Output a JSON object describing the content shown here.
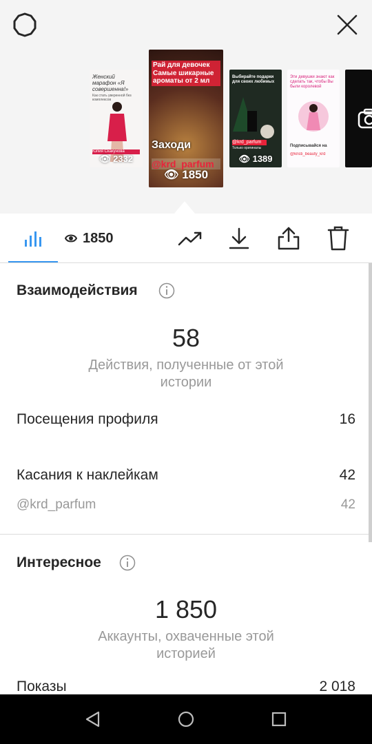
{
  "stories": [
    {
      "caption_top": "Женский марафон «Я совершенна!»",
      "caption_small": "Как стать уверенной без комплексов",
      "label": "Юлия Скакунова",
      "views": "2332"
    },
    {
      "caption_top": "Рай для девочек Самые шикарные ароматы от 2 мл",
      "caption_mid": "Заходи",
      "handle": "@krd_parfum",
      "views": "1850"
    },
    {
      "caption_top": "Выбирайте подарки для своих любимых",
      "handle": "@krd_parfum",
      "caption_small": "Только оригиналы",
      "views": "1389"
    },
    {
      "caption_top": "Эти девушки знают как сделать так, чтобы Вы были королевой",
      "caption_small": "Подписывайся на",
      "handle": "@kristi_beauty_krd"
    },
    {}
  ],
  "toolbar": {
    "views_count": "1850"
  },
  "interactions": {
    "title": "Взаимодействия",
    "total": "58",
    "total_caption": "Действия, полученные от этой истории",
    "rows": [
      {
        "label": "Посещения профиля",
        "value": "16"
      },
      {
        "label": "Касания к наклейкам",
        "value": "42"
      }
    ],
    "sub_rows": [
      {
        "label": "@krd_parfum",
        "value": "42"
      }
    ]
  },
  "discovery": {
    "title": "Интересное",
    "total": "1 850",
    "total_caption": "Аккаунты, охваченные этой историей",
    "rows": [
      {
        "label": "Показы",
        "value": "2 018"
      }
    ]
  },
  "colors": {
    "accent": "#3897f0",
    "handle_red": "#e8233a"
  },
  "icons": [
    "settings-gear-icon",
    "close-icon",
    "bar-chart-icon",
    "eye-icon",
    "trending-icon",
    "download-icon",
    "share-icon",
    "trash-icon",
    "camera-icon",
    "back-icon",
    "home-icon",
    "recents-icon"
  ]
}
